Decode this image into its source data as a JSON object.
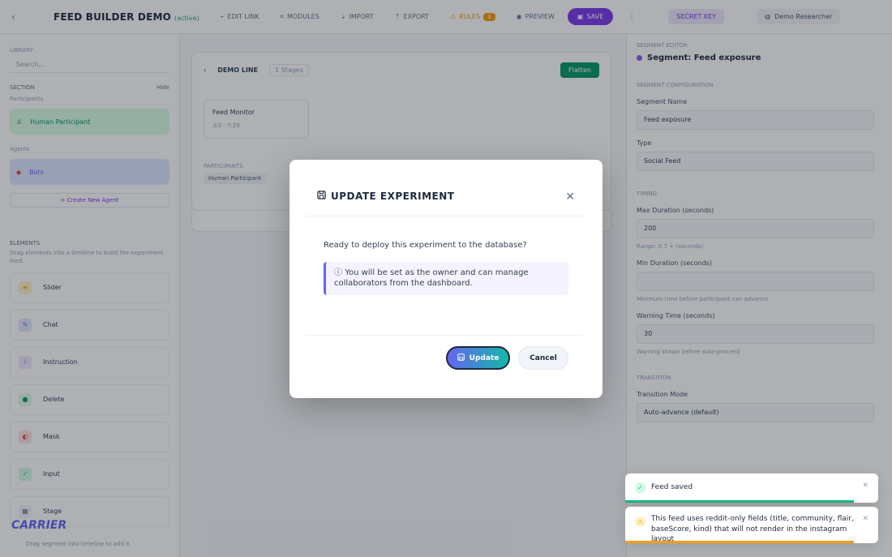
{
  "topbar": {
    "title": "FEED BUILDER DEMO",
    "badge": "(active)",
    "items": [
      "EDIT LINK",
      "MODULES",
      "IMPORT",
      "EXPORT"
    ],
    "warnings_label": "RULES",
    "warnings_count": "3",
    "preview": "PREVIEW",
    "save": "SAVE",
    "secret": "SECRET KEY",
    "user": "Demo Researcher"
  },
  "sidebar": {
    "search_label": "Library",
    "search_placeholder": "Search…",
    "section": "SECTION",
    "section_right": "Hide",
    "participants_label": "Participants",
    "participant_card": "Human Participant",
    "agents_label": "Agents",
    "agent_card": "Bots",
    "create_label": "+ Create New Agent",
    "elements_title": "ELEMENTS",
    "elements_hint": "Drag elements into a timeline to build the experiment feed.",
    "elements": [
      {
        "label": "Slider",
        "icon": "≡",
        "color": "#f59e0b",
        "bg": "#fef3c7"
      },
      {
        "label": "Chat",
        "icon": "✎",
        "color": "#6366f1",
        "bg": "#e0e7ff"
      },
      {
        "label": "Instruction",
        "icon": "i",
        "color": "#8b5cf6",
        "bg": "#ede9fe"
      },
      {
        "label": "Delete",
        "icon": "●",
        "color": "#059669",
        "bg": "#dcfce7"
      },
      {
        "label": "Mask",
        "icon": "◐",
        "color": "#ef4444",
        "bg": "#fee2e2"
      },
      {
        "label": "Input",
        "icon": "✓",
        "color": "#10b981",
        "bg": "#d1fae5"
      },
      {
        "label": "Stage",
        "icon": "▦",
        "color": "#64748b",
        "bg": "#f1f5f9"
      }
    ],
    "footer": "Drag segment into timeline to add it",
    "logo": "CARRIER"
  },
  "canvas": {
    "name": "DEMO LINE",
    "tag": "1 Stages",
    "button": "Flatten",
    "node_title": "Feed Monitor",
    "node_sub": "3/3 · 7:29",
    "sub_label": "PARTICIPANTS",
    "chip": "Human Participant"
  },
  "right": {
    "small": "SEGMENT EDITOR",
    "title": "Segment: Feed exposure",
    "sec1": "SEGMENT CONFIGURATION",
    "name_label": "Segment Name",
    "name_value": "Feed exposure",
    "type_label": "Type",
    "type_value": "Social Feed",
    "sec2": "TIMING",
    "max_label": "Max Duration (seconds)",
    "max_value": "200",
    "max_help": "Range: 0.7 + (seconds)",
    "min_label": "Min Duration (seconds)",
    "min_value": "",
    "min_help": "Minimum time before participant can advance",
    "warn_label": "Warning Time (seconds)",
    "warn_value": "30",
    "warn_help": "Warning shown before auto-proceed",
    "sec3": "TRANSITION",
    "trans_label": "Transition Mode",
    "trans_value": "Auto-advance (default)"
  },
  "modal": {
    "title": "UPDATE EXPERIMENT",
    "question": "Ready to deploy this experiment to the database?",
    "info": "You will be set as the owner and can manage collaborators from the dashboard.",
    "update": "Update",
    "cancel": "Cancel"
  },
  "toasts": [
    {
      "text": "Feed saved",
      "type": "success",
      "color": "#10b981"
    },
    {
      "text": "This feed uses reddit-only fields (title, community, flair, baseScore, kind) that will not render in the instagram layout",
      "type": "warning",
      "color": "#f59e0b"
    }
  ]
}
